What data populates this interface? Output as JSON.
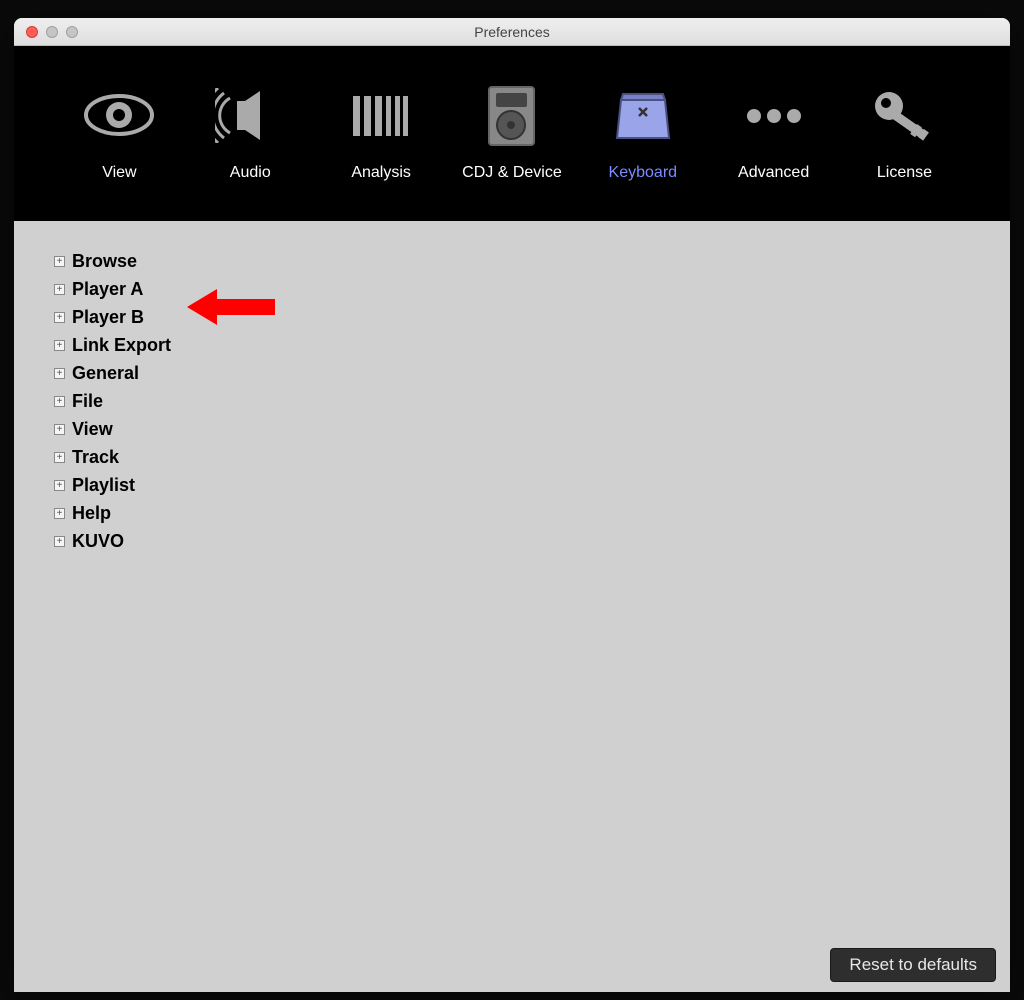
{
  "window": {
    "title": "Preferences"
  },
  "tabs": [
    {
      "id": "view",
      "label": "View",
      "active": false,
      "icon": "eye"
    },
    {
      "id": "audio",
      "label": "Audio",
      "active": false,
      "icon": "speaker"
    },
    {
      "id": "analysis",
      "label": "Analysis",
      "active": false,
      "icon": "bars"
    },
    {
      "id": "cdj",
      "label": "CDJ & Device",
      "active": false,
      "icon": "device"
    },
    {
      "id": "keyboard",
      "label": "Keyboard",
      "active": true,
      "icon": "keyboard"
    },
    {
      "id": "advanced",
      "label": "Advanced",
      "active": false,
      "icon": "dots"
    },
    {
      "id": "license",
      "label": "License",
      "active": false,
      "icon": "key"
    }
  ],
  "tree": {
    "items": [
      {
        "label": "Browse"
      },
      {
        "label": "Player A"
      },
      {
        "label": "Player B"
      },
      {
        "label": "Link Export"
      },
      {
        "label": "General"
      },
      {
        "label": "File"
      },
      {
        "label": "View"
      },
      {
        "label": "Track"
      },
      {
        "label": "Playlist"
      },
      {
        "label": "Help"
      },
      {
        "label": "KUVO"
      }
    ]
  },
  "footer": {
    "reset_label": "Reset to defaults"
  },
  "annotation": {
    "type": "arrow",
    "points_to": "Player A",
    "color": "#ff0000"
  }
}
